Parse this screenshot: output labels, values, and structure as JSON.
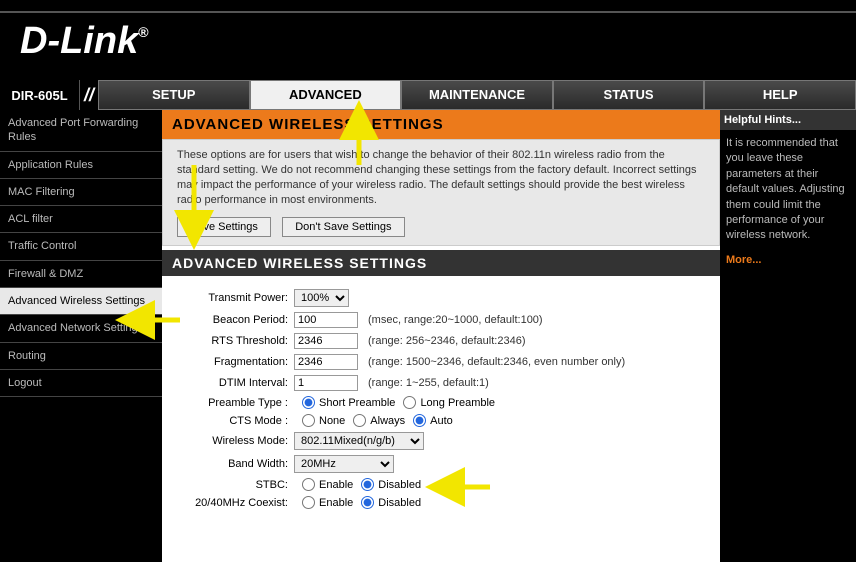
{
  "brand": "D-Link",
  "model": "DIR-605L",
  "tabs": [
    "SETUP",
    "ADVANCED",
    "MAINTENANCE",
    "STATUS",
    "HELP"
  ],
  "active_tab": "ADVANCED",
  "sidebar": {
    "items": [
      "Advanced Port Forwarding Rules",
      "Application Rules",
      "MAC Filtering",
      "ACL filter",
      "Traffic Control",
      "Firewall & DMZ",
      "Advanced Wireless Settings",
      "Advanced Network Settings",
      "Routing",
      "Logout"
    ],
    "active_index": 6
  },
  "panel": {
    "title": "ADVANCED WIRELESS SETTINGS",
    "desc": "These options are for users that wish to change the behavior of their 802.11n wireless radio from the standard setting. We do not recommend changing these settings from the factory default. Incorrect settings may impact the performance of your wireless radio. The default settings should provide the best wireless radio performance in most environments.",
    "save_label": "Save Settings",
    "dont_save_label": "Don't Save Settings",
    "section_title": "ADVANCED WIRELESS SETTINGS"
  },
  "form": {
    "transmit_power": {
      "label": "Transmit Power:",
      "value": "100%"
    },
    "beacon_period": {
      "label": "Beacon Period:",
      "value": "100",
      "note": "(msec, range:20~1000, default:100)"
    },
    "rts_threshold": {
      "label": "RTS Threshold:",
      "value": "2346",
      "note": "(range: 256~2346, default:2346)"
    },
    "fragmentation": {
      "label": "Fragmentation:",
      "value": "2346",
      "note": "(range: 1500~2346, default:2346, even number only)"
    },
    "dtim_interval": {
      "label": "DTIM Interval:",
      "value": "1",
      "note": "(range: 1~255, default:1)"
    },
    "preamble": {
      "label": "Preamble Type :",
      "opt_short": "Short Preamble",
      "opt_long": "Long Preamble",
      "selected": "short"
    },
    "cts_mode": {
      "label": "CTS Mode :",
      "opt_none": "None",
      "opt_always": "Always",
      "opt_auto": "Auto",
      "selected": "auto"
    },
    "wireless_mode": {
      "label": "Wireless Mode:",
      "value": "802.11Mixed(n/g/b)"
    },
    "band_width": {
      "label": "Band Width:",
      "value": "20MHz"
    },
    "stbc": {
      "label": "STBC:",
      "opt_enable": "Enable",
      "opt_disabled": "Disabled",
      "selected": "disabled"
    },
    "coexist": {
      "label": "20/40MHz Coexist:",
      "opt_enable": "Enable",
      "opt_disabled": "Disabled",
      "selected": "disabled"
    }
  },
  "help": {
    "title": "Helpful Hints...",
    "text": "It is recommended that you leave these parameters at their default values. Adjusting them could limit the performance of your wireless network.",
    "more": "More..."
  }
}
